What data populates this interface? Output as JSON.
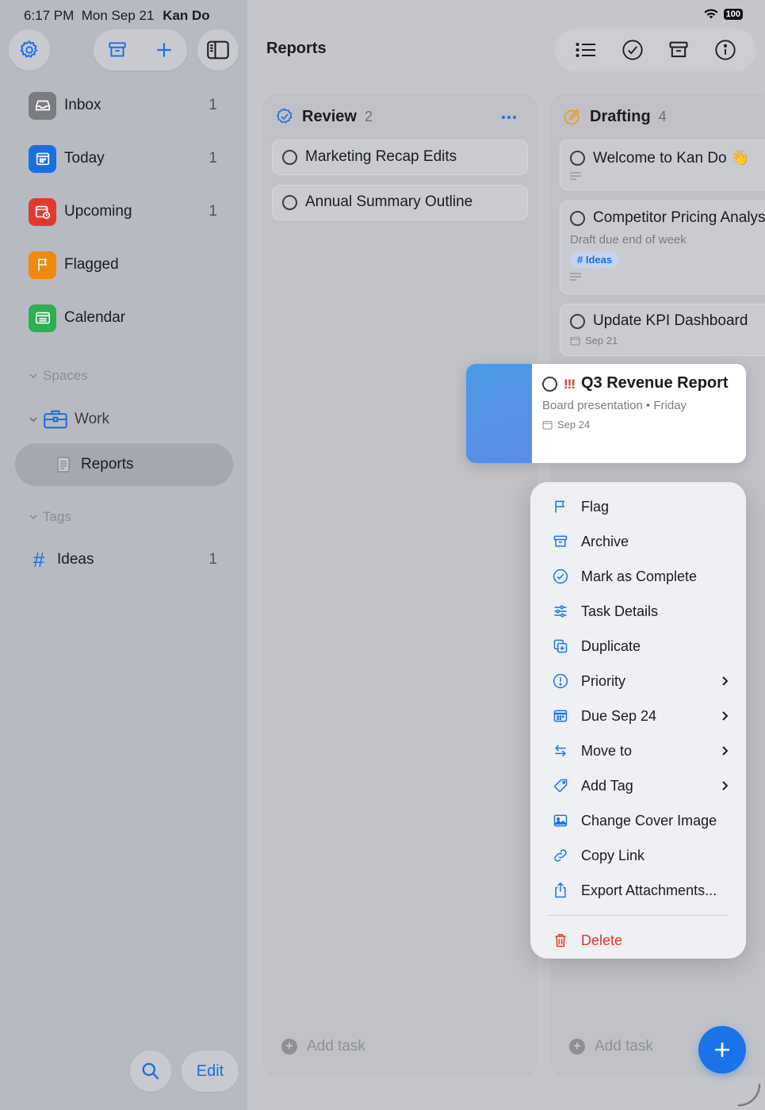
{
  "status_bar": {
    "time": "6:17 PM",
    "date": "Mon Sep 21",
    "app_owner": "Kan Do",
    "battery": "100"
  },
  "sidebar": {
    "nav": [
      {
        "label": "Inbox",
        "count": "1",
        "icon": "inbox-icon",
        "color": "#7a7c80"
      },
      {
        "label": "Today",
        "count": "1",
        "icon": "calendar-grid-icon",
        "color": "#1a6fe0"
      },
      {
        "label": "Upcoming",
        "count": "1",
        "icon": "calendar-clock-icon",
        "color": "#e03a2f"
      },
      {
        "label": "Flagged",
        "count": "",
        "icon": "flag-icon",
        "color": "#ef8a0c"
      },
      {
        "label": "Calendar",
        "count": "",
        "icon": "calendar-list-icon",
        "color": "#2fae52"
      }
    ],
    "spaces_header": "Spaces",
    "space": {
      "label": "Work",
      "icon": "briefcase-icon"
    },
    "board": {
      "label": "Reports",
      "icon": "document-icon"
    },
    "tags_header": "Tags",
    "tags": [
      {
        "label": "Ideas",
        "count": "1",
        "icon": "hashtag-icon"
      }
    ],
    "edit_label": "Edit"
  },
  "toolbar": {
    "title": "Reports"
  },
  "columns": [
    {
      "name": "Review",
      "count": "2",
      "cards": [
        {
          "title": "Marketing Recap Edits"
        },
        {
          "title": "Annual Summary Outline"
        }
      ],
      "add_task": "Add task"
    },
    {
      "name": "Drafting",
      "count": "4",
      "cards": [
        {
          "title": "Welcome to Kan Do 👋"
        },
        {
          "title": "Competitor Pricing Analysis",
          "subtitle": "Draft due end of week",
          "tag": "# Ideas"
        },
        {
          "title": "Update KPI Dashboard",
          "date": "Sep 21"
        }
      ],
      "add_task": "Add task"
    }
  ],
  "selected_card": {
    "title": "Q3 Revenue Report",
    "priority_marker": "!!!",
    "subtitle": "Board presentation",
    "due_day": "Friday",
    "date": "Sep 24"
  },
  "context_menu": {
    "items": [
      {
        "label": "Flag",
        "icon": "flag-icon",
        "submenu": false
      },
      {
        "label": "Archive",
        "icon": "archive-icon",
        "submenu": false
      },
      {
        "label": "Mark as Complete",
        "icon": "checkmark-circle-icon",
        "submenu": false
      },
      {
        "label": "Task Details",
        "icon": "sliders-icon",
        "submenu": false
      },
      {
        "label": "Duplicate",
        "icon": "duplicate-icon",
        "submenu": false
      },
      {
        "label": "Priority",
        "icon": "exclamation-circle-icon",
        "submenu": true
      },
      {
        "label": "Due Sep 24",
        "icon": "calendar-icon",
        "submenu": true
      },
      {
        "label": "Move to",
        "icon": "arrows-swap-icon",
        "submenu": true
      },
      {
        "label": "Add Tag",
        "icon": "tag-icon",
        "submenu": true
      },
      {
        "label": "Change Cover Image",
        "icon": "image-icon",
        "submenu": false
      },
      {
        "label": "Copy Link",
        "icon": "link-icon",
        "submenu": false
      },
      {
        "label": "Export Attachments...",
        "icon": "share-icon",
        "submenu": false
      }
    ],
    "delete_label": "Delete"
  },
  "colors": {
    "accent": "#1a73e8",
    "destructive": "#e5352c",
    "review_icon": "#2f6fd8",
    "drafting_icon": "#f09a1a"
  }
}
